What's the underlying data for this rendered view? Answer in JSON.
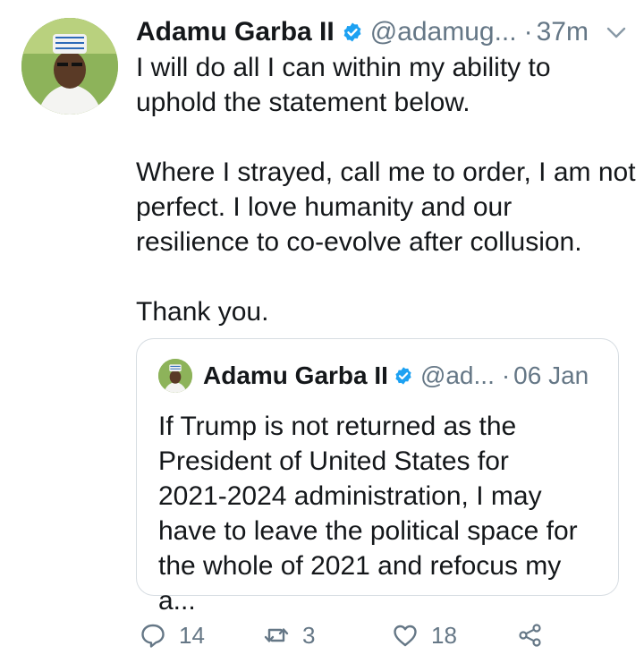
{
  "tweet": {
    "author_name": "Adamu Garba II",
    "handle": "@adamug...",
    "separator": "·",
    "time": "37m",
    "text_lines": [
      "I will do all I can within my ability to",
      "uphold the statement below.",
      "",
      "Where I strayed, call me to order, I am not",
      "perfect. I love humanity and our",
      "resilience to co-evolve after collusion.",
      "",
      "Thank you."
    ]
  },
  "quoted_tweet": {
    "author_name": "Adamu Garba II",
    "handle": "@ad...",
    "separator": "·",
    "time": "06 Jan",
    "text_lines": [
      "If Trump is not returned as the",
      "President of United States for",
      "2021-2024 administration, I may",
      "have to leave the political space for",
      "the whole of 2021 and refocus my a..."
    ]
  },
  "actions": {
    "reply_count": "14",
    "retweet_count": "3",
    "like_count": "18"
  },
  "icons": {
    "verified": "verified-badge-icon",
    "more": "chevron-down-icon",
    "reply": "reply-icon",
    "retweet": "retweet-icon",
    "like": "heart-icon",
    "share": "share-icon"
  },
  "colors": {
    "verified_blue": "#1da1f2",
    "secondary_text": "#657786",
    "primary_text": "#14171a",
    "border": "#d7dde2"
  }
}
